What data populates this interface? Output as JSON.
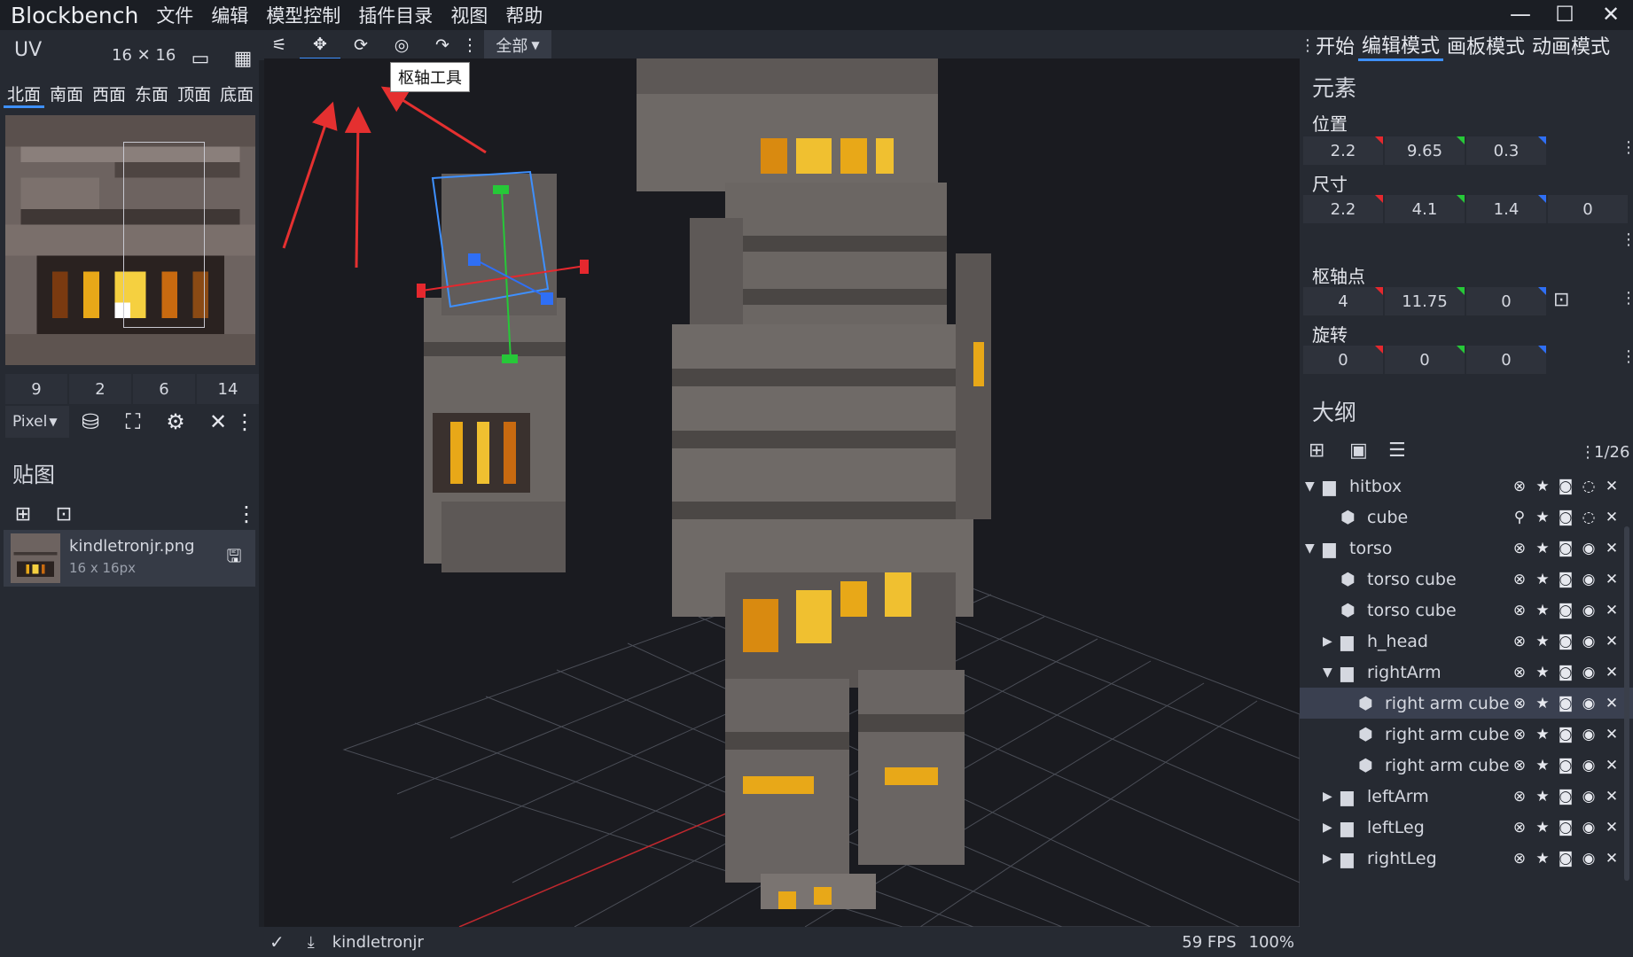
{
  "app": {
    "name": "Blockbench"
  },
  "menu": [
    "文件",
    "编辑",
    "模型控制",
    "插件目录",
    "视图",
    "帮助"
  ],
  "window_controls": {
    "minimize": "—",
    "maximize": "☐",
    "close": "✕"
  },
  "uv_panel": {
    "title": "UV",
    "size_label": "16 ✕ 16",
    "faces": [
      "北面",
      "南面",
      "西面",
      "东面",
      "顶面",
      "底面"
    ],
    "active_face": "北面",
    "values": [
      "9",
      "2",
      "6",
      "14"
    ],
    "mode_select": "Pixel"
  },
  "textures_panel": {
    "title": "贴图",
    "texture_name": "kindletronjr.png",
    "texture_size": "16 x 16px"
  },
  "toolbar": {
    "tooltip": "枢轴工具",
    "select_value": "全部"
  },
  "modes": [
    "开始",
    "编辑模式",
    "画板模式",
    "动画模式"
  ],
  "active_mode": "编辑模式",
  "element_panel": {
    "title": "元素",
    "position_label": "位置",
    "position": [
      "2.2",
      "9.65",
      "0.3"
    ],
    "size_label": "尺寸",
    "size": [
      "2.2",
      "4.1",
      "1.4",
      "0"
    ],
    "pivot_label": "枢轴点",
    "pivot": [
      "4",
      "11.75",
      "0"
    ],
    "rotation_label": "旋转",
    "rotation": [
      "0",
      "0",
      "0"
    ]
  },
  "outliner": {
    "title": "大纲",
    "count": "1/26",
    "rows": [
      {
        "label": "hitbox",
        "type": "folder",
        "expanded": true
      },
      {
        "label": "cube",
        "type": "cube"
      },
      {
        "label": "torso",
        "type": "folder",
        "expanded": true
      },
      {
        "label": "torso cube",
        "type": "cube"
      },
      {
        "label": "torso cube",
        "type": "cube"
      },
      {
        "label": "h_head",
        "type": "folder",
        "expanded": false
      },
      {
        "label": "rightArm",
        "type": "folder",
        "expanded": true
      },
      {
        "label": "right arm cube",
        "type": "cube",
        "selected": true
      },
      {
        "label": "right arm cube",
        "type": "cube"
      },
      {
        "label": "right arm cube",
        "type": "cube"
      },
      {
        "label": "leftArm",
        "type": "folder",
        "expanded": false
      },
      {
        "label": "leftLeg",
        "type": "folder",
        "expanded": false
      },
      {
        "label": "rightLeg",
        "type": "folder",
        "expanded": false
      }
    ]
  },
  "status": {
    "project": "kindletronjr",
    "fps": "59 FPS",
    "zoom": "100%"
  },
  "colors": {
    "accent": "#3e90ff",
    "x_axis": "#e5282e",
    "y_axis": "#26c838",
    "z_axis": "#2f6ff5",
    "annotation": "#e53030"
  }
}
